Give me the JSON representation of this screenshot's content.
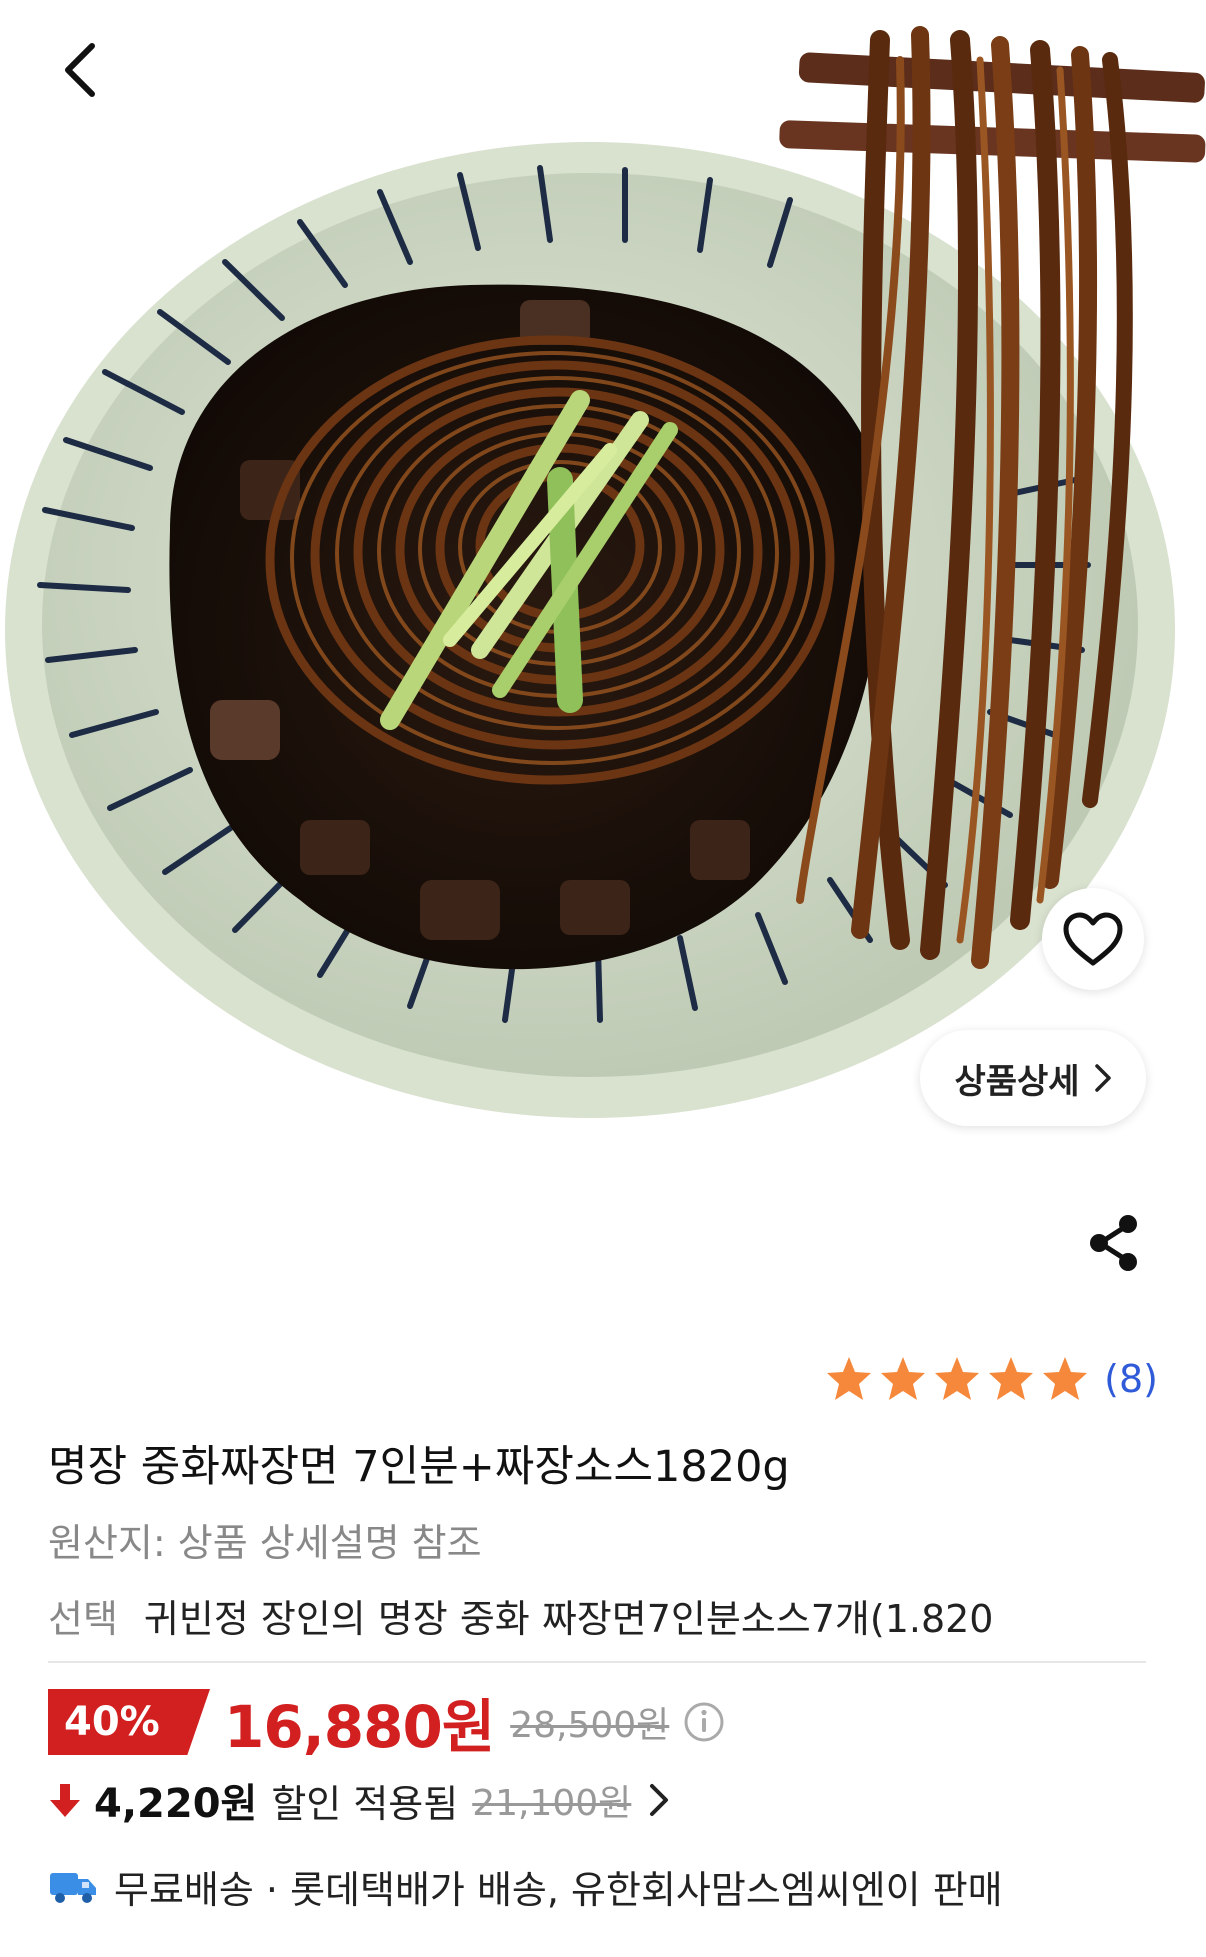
{
  "header": {
    "back_icon": "chevron-left-icon",
    "wishlist_icon": "heart-icon",
    "detail_button_label": "상품상세",
    "share_icon": "share-icon"
  },
  "product": {
    "rating_stars": 5,
    "review_count": "(8)",
    "title": "명장 중화짜장면 7인분+짜장소스1820g",
    "origin": "원산지: 상품 상세설명 참조",
    "option_label": "선택",
    "option_value": "귀빈정 장인의 명장 중화 짜장면7인분소스7개(1.820"
  },
  "price": {
    "discount_rate": "40%",
    "sale_price": "16,880원",
    "original_price": "28,500원",
    "coupon_price": "4,220원",
    "coupon_text": "할인 적용됨",
    "coupon_original": "21,100원"
  },
  "shipping": {
    "text": "무료배송 · 롯데택배가 배송, 유한회사맘스엠씨엔이 판매"
  },
  "colors": {
    "accent_red": "#d21f1f",
    "star_orange": "#f5883a",
    "link_blue": "#2f5bd8",
    "truck_blue": "#3a8ee6"
  }
}
